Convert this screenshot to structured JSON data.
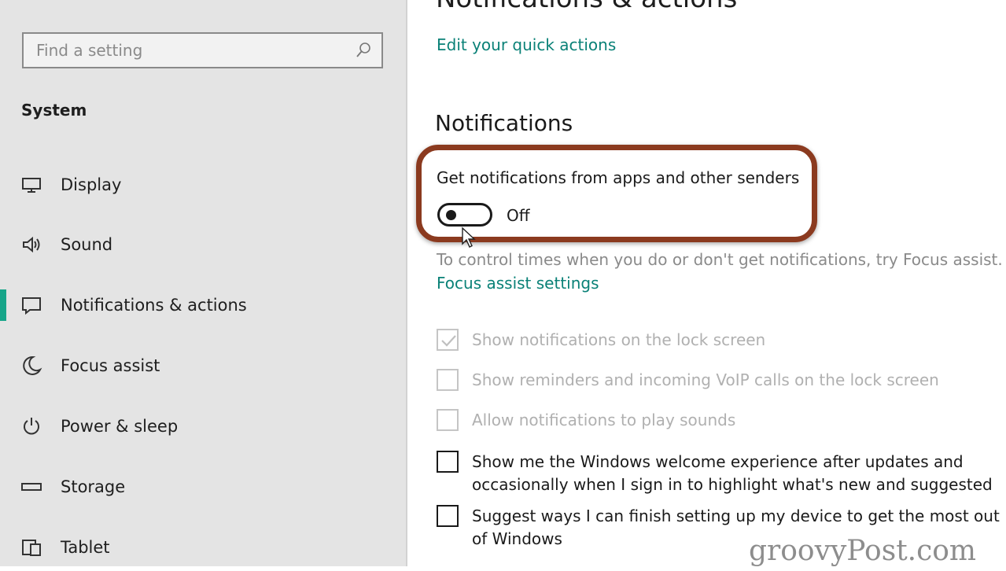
{
  "sidebar": {
    "search_placeholder": "Find a setting",
    "section": "System",
    "items": [
      {
        "label": "Display"
      },
      {
        "label": "Sound"
      },
      {
        "label": "Notifications & actions"
      },
      {
        "label": "Focus assist"
      },
      {
        "label": "Power & sleep"
      },
      {
        "label": "Storage"
      },
      {
        "label": "Tablet"
      }
    ],
    "active_index": 2
  },
  "main": {
    "title": "Notifications & actions",
    "quick_actions_link": "Edit your quick actions",
    "notifications_heading": "Notifications",
    "toggle": {
      "label": "Get notifications from apps and other senders",
      "state": "Off"
    },
    "focus_assist_text": "To control times when you do or don't get notifications, try Focus assist.",
    "focus_assist_link": "Focus assist settings",
    "checkboxes": [
      {
        "label": "Show notifications on the lock screen",
        "checked": true,
        "disabled": true
      },
      {
        "label": "Show reminders and incoming VoIP calls on the lock screen",
        "checked": false,
        "disabled": true
      },
      {
        "label": "Allow notifications to play sounds",
        "checked": false,
        "disabled": true
      },
      {
        "label": "Show me the Windows welcome experience after updates and occasionally when I sign in to highlight what's new and suggested",
        "checked": false,
        "disabled": false
      },
      {
        "label": "Suggest ways I can finish setting up my device to get the most out of Windows",
        "checked": false,
        "disabled": false
      }
    ]
  },
  "watermark": "groovyPost.com",
  "colors": {
    "accent": "#17a589",
    "link": "#0a8177",
    "highlight_ring": "#8b3a1f"
  }
}
